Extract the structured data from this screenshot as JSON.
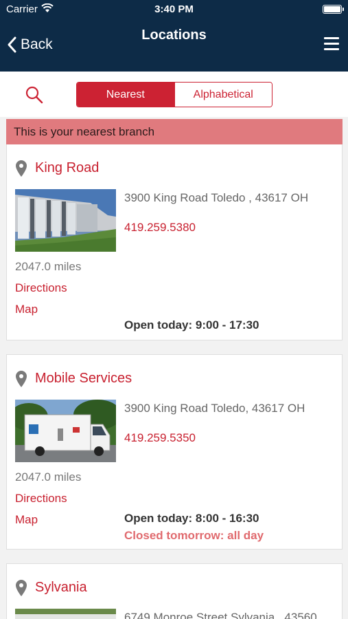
{
  "status_bar": {
    "carrier": "Carrier",
    "time": "3:40 PM"
  },
  "nav": {
    "back_label": "Back",
    "title": "Locations"
  },
  "filter": {
    "nearest_label": "Nearest",
    "alphabetical_label": "Alphabetical",
    "selected": "Nearest"
  },
  "banner": {
    "text": "This is your nearest branch"
  },
  "locations": [
    {
      "name": "King Road",
      "address": "3900 King Road Toledo , 43617 OH",
      "phone": "419.259.5380",
      "distance": "2047.0 miles",
      "directions_label": "Directions",
      "map_label": "Map",
      "hours_today": "Open today: 9:00 - 17:30"
    },
    {
      "name": "Mobile Services",
      "address": "3900 King Road Toledo, 43617 OH",
      "phone": "419.259.5350",
      "distance": "2047.0 miles",
      "directions_label": "Directions",
      "map_label": "Map",
      "hours_today": "Open today: 8:00 - 16:30",
      "hours_tomorrow": "Closed tomorrow: all day"
    },
    {
      "name": "Sylvania",
      "address": "6749 Monroe Street Sylvania , 43560"
    }
  ],
  "colors": {
    "header": "#0d2b47",
    "accent": "#cc2233",
    "banner": "#e07a7e"
  }
}
